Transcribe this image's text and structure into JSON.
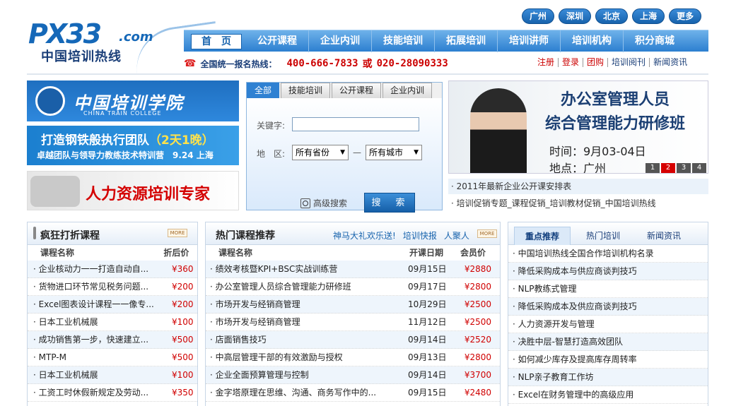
{
  "header": {
    "logo_mark": "PX33",
    "logo_domain": ".com",
    "logo_cn": "中国培训热线",
    "cities": [
      "广州",
      "深圳",
      "北京",
      "上海",
      "更多"
    ],
    "nav": [
      "首　页",
      "公开课程",
      "企业内训",
      "技能培训",
      "拓展培训",
      "培训讲师",
      "培训机构",
      "积分商城"
    ],
    "hotline_label": "全国统一报名热线：",
    "hotline_1": "400-666-7833",
    "hotline_or": "或",
    "hotline_2": "020-28090333",
    "top_links": [
      "注册",
      "登录",
      "团购",
      "培训阅刊",
      "新闻资讯"
    ]
  },
  "banners": {
    "b1_text": "中国培训学院",
    "b1_sub": "CHINA TRAIN COLLEGE",
    "b2_line1_a": "打造钢铁般执行团队",
    "b2_line1_b": "（2天1晚）",
    "b2_line2": "卓越团队与领导力教练技术特训营　9.24 上海",
    "b3_text": "人力资源培训专家"
  },
  "search": {
    "tabs": [
      "全部",
      "技能培训",
      "公开课程",
      "企业内训"
    ],
    "keyword_label": "关键字:",
    "region_label": "地　区:",
    "province": "所有省份",
    "dash": "—",
    "city": "所有城市",
    "advanced": "高级搜索",
    "submit": "搜　索"
  },
  "promo": {
    "title1": "办公室管理人员",
    "title2": "综合管理能力研修班",
    "date": "时间：9月03-04日",
    "place": "地点：广州",
    "pages": [
      "1",
      "2",
      "3",
      "4"
    ],
    "active_page": "2",
    "news1": "· 2011年最新企业公开课安排表",
    "news2": "· 培训促销专题_课程促销_培训教材促销_中国培训热线"
  },
  "panel1": {
    "title": "疯狂打折课程",
    "more": "MORE",
    "col_name": "课程名称",
    "col_price": "折后价",
    "rows": [
      {
        "name": "· 企业核动力一一打造自动自...",
        "price": "¥360"
      },
      {
        "name": "· 货物进口环节常见税务问题...",
        "price": "¥200"
      },
      {
        "name": "· Excel图表设计课程一一像专...",
        "price": "¥200"
      },
      {
        "name": "· 日本工业机械展",
        "price": "¥100"
      },
      {
        "name": "· 成功销售第一步，快速建立...",
        "price": "¥500"
      },
      {
        "name": "· MTP-M",
        "price": "¥500"
      },
      {
        "name": "· 日本工业机械展",
        "price": "¥100"
      },
      {
        "name": "· 工资工时休假新规定及劳动...",
        "price": "¥350"
      }
    ]
  },
  "panel2": {
    "title": "热门课程推荐",
    "links": [
      "神马大礼欢乐送!",
      "培训快报",
      "人聚人"
    ],
    "more": "MORE",
    "col_name": "课程名称",
    "col_date": "开课日期",
    "col_price": "会员价",
    "rows": [
      {
        "name": "· 绩效考核暨KPI+BSC实战训练营",
        "date": "09月15日",
        "price": "¥2880"
      },
      {
        "name": "· 办公室管理人员综合管理能力研修班",
        "date": "09月17日",
        "price": "¥2800"
      },
      {
        "name": "· 市场开发与经销商管理",
        "date": "10月29日",
        "price": "¥2500"
      },
      {
        "name": "· 市场开发与经销商管理",
        "date": "11月12日",
        "price": "¥2500"
      },
      {
        "name": "· 店面销售技巧",
        "date": "09月14日",
        "price": "¥2520"
      },
      {
        "name": "· 中高层管理干部的有效激励与授权",
        "date": "09月13日",
        "price": "¥2800"
      },
      {
        "name": "· 企业全面预算管理与控制",
        "date": "09月14日",
        "price": "¥3700"
      },
      {
        "name": "· 金字塔原理在思维、沟通、商务写作中的...",
        "date": "09月15日",
        "price": "¥2480"
      }
    ]
  },
  "panel3": {
    "tabs": [
      "重点推荐",
      "热门培训",
      "新闻资讯"
    ],
    "active_tab": "重点推荐",
    "rows": [
      "· 中国培训热线全国合作培训机构名录",
      "· 降低采购成本与供应商谈判技巧",
      "· NLP教练式管理",
      "· 降低采购成本及供应商谈判技巧",
      "· 人力资源开发与管理",
      "· 决胜中层-智慧打造高效团队",
      "· 如何减少库存及提高库存周转率",
      "· NLP亲子教育工作坊",
      "· Excel在财务管理中的高级应用"
    ]
  },
  "colors": {
    "brand_blue": "#1763ad",
    "price_red": "#d00000",
    "promo_red": "#d60000"
  }
}
